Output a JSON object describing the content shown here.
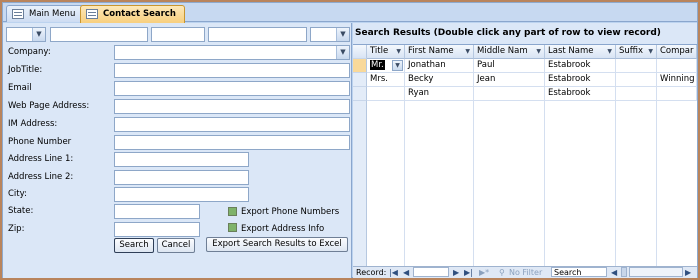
{
  "tabs": [
    {
      "label": "Main Menu",
      "active": false
    },
    {
      "label": "Contact Search",
      "active": true
    }
  ],
  "form": {
    "labels": {
      "company": "Company:",
      "job_title": "JobTitle:",
      "email": "Email",
      "web_page": "Web Page Address:",
      "im": "IM Address:",
      "phone": "Phone Number",
      "address1": "Address Line 1:",
      "address2": "Address Line 2:",
      "city": "City:",
      "state": "State:",
      "zip": "Zip:"
    },
    "export_phone_label": "Export Phone Numbers",
    "export_address_label": "Export Address Info",
    "search_button": "Search",
    "cancel_button": "Cancel",
    "export_button": "Export Search Results to Excel"
  },
  "results": {
    "title": "Search Results (Double click any part of row to view record)",
    "columns": [
      "Title",
      "First Name",
      "Middle Nam",
      "Last Name",
      "Suffix",
      "Compar"
    ],
    "rows": [
      [
        "Mr.",
        "Jonathan",
        "Paul",
        "Estabrook",
        "",
        ""
      ],
      [
        "Mrs.",
        "Becky",
        "Jean",
        "Estabrook",
        "",
        "Winning"
      ],
      [
        "",
        "Ryan",
        "",
        "Estabrook",
        "",
        ""
      ]
    ]
  },
  "navigation": {
    "record_label": "Record:",
    "first": "|◀",
    "prev": "◀",
    "next": "▶",
    "last": "▶|",
    "new": "▶*",
    "no_filter": "No Filter",
    "search": "Search"
  },
  "icons": {
    "combo": "chevron-down-icon",
    "filter": "filter-icon",
    "tab": "form-icon"
  },
  "colors": {
    "active_tab": "#f8cf7e",
    "pane": "#dbe7f7",
    "checkbox": "#7fb36a"
  }
}
